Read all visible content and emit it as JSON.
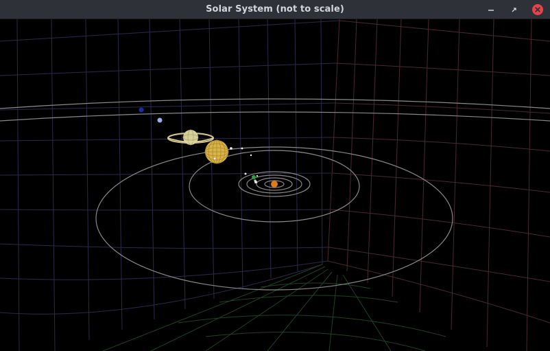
{
  "window": {
    "title": "Solar System (not to scale)",
    "controls": {
      "minimize": "minimize-icon",
      "restore": "restore-icon",
      "close": "close-icon"
    }
  },
  "scene": {
    "background": "#000000",
    "grid_colors": {
      "left_wall": "#2c2b4a",
      "right_wall": "#4a2a30",
      "floor": "#1f4226"
    },
    "orbit_color": "#8a8a8a",
    "bodies": [
      {
        "name": "sun",
        "color": "#e07a18"
      },
      {
        "name": "mercury",
        "color": "#cfcfcf"
      },
      {
        "name": "venus",
        "color": "#e6e6e6"
      },
      {
        "name": "earth",
        "color": "#2fa03a"
      },
      {
        "name": "mars",
        "color": "#e8e8e8"
      },
      {
        "name": "jupiter",
        "color": "#d8b44a"
      },
      {
        "name": "saturn",
        "color": "#d6cf9a"
      },
      {
        "name": "uranus",
        "color": "#9fb0e8"
      },
      {
        "name": "neptune",
        "color": "#1f2aa8"
      }
    ]
  }
}
